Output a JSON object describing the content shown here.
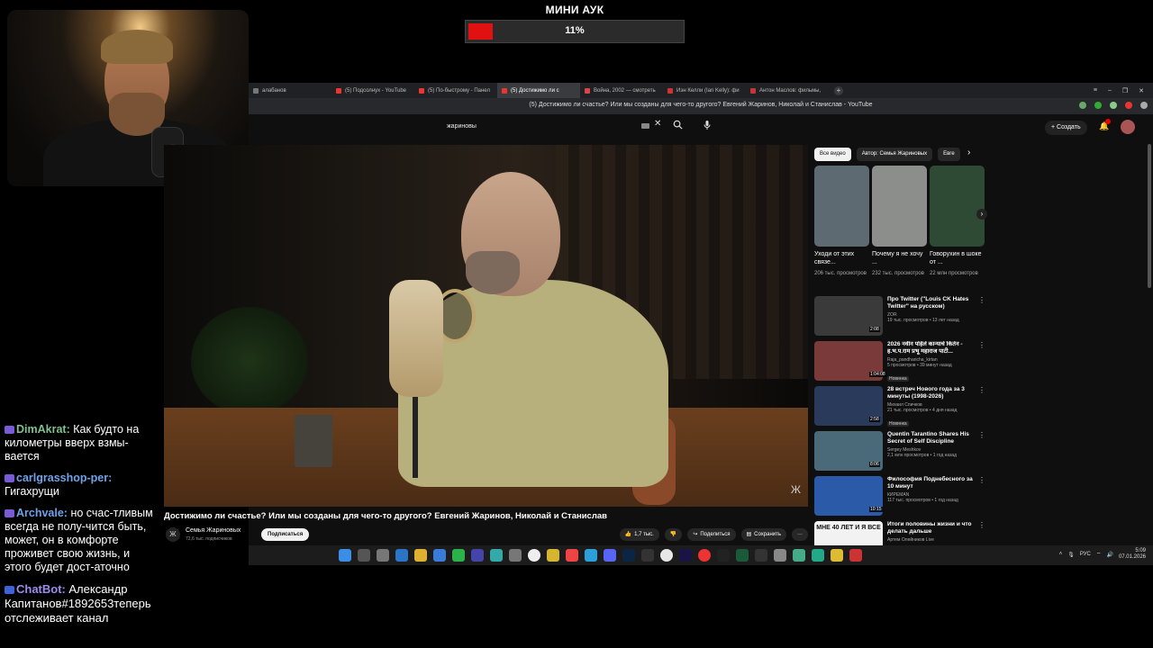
{
  "overlay": {
    "auction_title": "МИНИ АУК",
    "progress_label": "11%",
    "progress_fraction": 0.11,
    "bar_color": "#e11111"
  },
  "chat": {
    "messages": [
      {
        "user": "DimAkrat:",
        "text": "Как будто на километры вверх взмы-вается"
      },
      {
        "user": "carlgrasshop-per:",
        "text": "Гигахрущи"
      },
      {
        "user": "Archvale:",
        "text": "но счас-тливым всегда не полу-чится быть, может, он в комфорте проживет свою жизнь, и этого будет дост-аточно"
      },
      {
        "user": "ChatBot:",
        "text": "Александр Капитанов#1892653теперь отслеживает канал"
      }
    ]
  },
  "browser": {
    "tabs": [
      {
        "label": "алабанов"
      },
      {
        "label": "(5) Подсолнух - YouTube"
      },
      {
        "label": "(5) По-быстрому - Панел"
      },
      {
        "label": "(5) Достижимо ли с"
      },
      {
        "label": "Война, 2002 — смотреть"
      },
      {
        "label": "Иэн Келли (Ian Kelly): фи"
      },
      {
        "label": "Антон Маслов: фильмы,"
      }
    ],
    "page_title": "(5) Достижимо ли счастье? Или мы созданы для чего-то другого? Евгений Жаринов, Николай и Станислав - YouTube"
  },
  "youtube": {
    "search_value": "жариновы",
    "create_label": "Создать",
    "notification_count": "9+",
    "video_title": "Достижимо ли счастье? Или мы созданы для чего-то другого? Евгений Жаринов, Николай и Станислав",
    "channel_name": "Семья Жариновых",
    "channel_subs": "72,6 тыс. подписчиков",
    "subscribe_label": "Подписаться",
    "like_count": "1,7 тыс.",
    "share_label": "Поделиться",
    "save_label": "Сохранить",
    "chips": [
      "Все видео",
      "Автор: Семья Жариновых",
      "Евге"
    ],
    "shorts": [
      {
        "title": "Уходи от этих связе...",
        "views": "206 тыс. просмотров",
        "color": "#5e6a72"
      },
      {
        "title": "Почему я не хочу ...",
        "views": "232 тыс. просмотров",
        "color": "#8b8e8a"
      },
      {
        "title": "Говорухин в шоке от ...",
        "views": "22 млн просмотров",
        "color": "#2f4a34"
      }
    ],
    "recommendations": [
      {
        "title": "Про Twitter (\"Louis CK Hates Twitter\" на русском)",
        "channel": "ZOR",
        "meta": "19 тыс. просмотров • 13 лет назад",
        "duration": "2:08",
        "badge": "",
        "color": "#3a3a3a"
      },
      {
        "title": "2026 नवीन पहिले कान्याचे किर्तन - ह.भ.प.राम प्रभू महाराज पाटी...",
        "channel": "Raja_pandharicha_kirtan",
        "meta": "5 просмотров • 39 минут назад",
        "duration": "1:04:08",
        "badge": "Новинка",
        "color": "#7a3a3a"
      },
      {
        "title": "28 встреч Нового года за 3 минуты (1998-2026)",
        "channel": "Михаил Спичков",
        "meta": "21 тыс. просмотров • 4 дня назад",
        "duration": "2:58",
        "badge": "Новинка",
        "color": "#2a3a5a"
      },
      {
        "title": "Quentin Tarantino Shares His Secret of Self Discipline",
        "channel": "Sergey Meshkov",
        "meta": "2,1 млн просмотров • 1 год назад",
        "duration": "8:06",
        "badge": "",
        "color": "#4a6a7a"
      },
      {
        "title": "Философия Поднебесного за 10 минут",
        "channel": "КИРЕМАN",
        "meta": "117 тыс. просмотров • 1 год назад",
        "duration": "10:15",
        "badge": "",
        "color": "#2a5aa8"
      },
      {
        "title": "Итоги половины жизни и что делать дальше",
        "channel": "Артем Олейников Live",
        "meta": "",
        "duration": "",
        "badge": "",
        "thumb_text": "МНЕ 40 ЛЕТ И Я ВСЕ",
        "color": "#f2f2f2"
      }
    ]
  },
  "taskbar": {
    "lang": "РУС",
    "time": "5:09",
    "date": "07.01.2026"
  }
}
